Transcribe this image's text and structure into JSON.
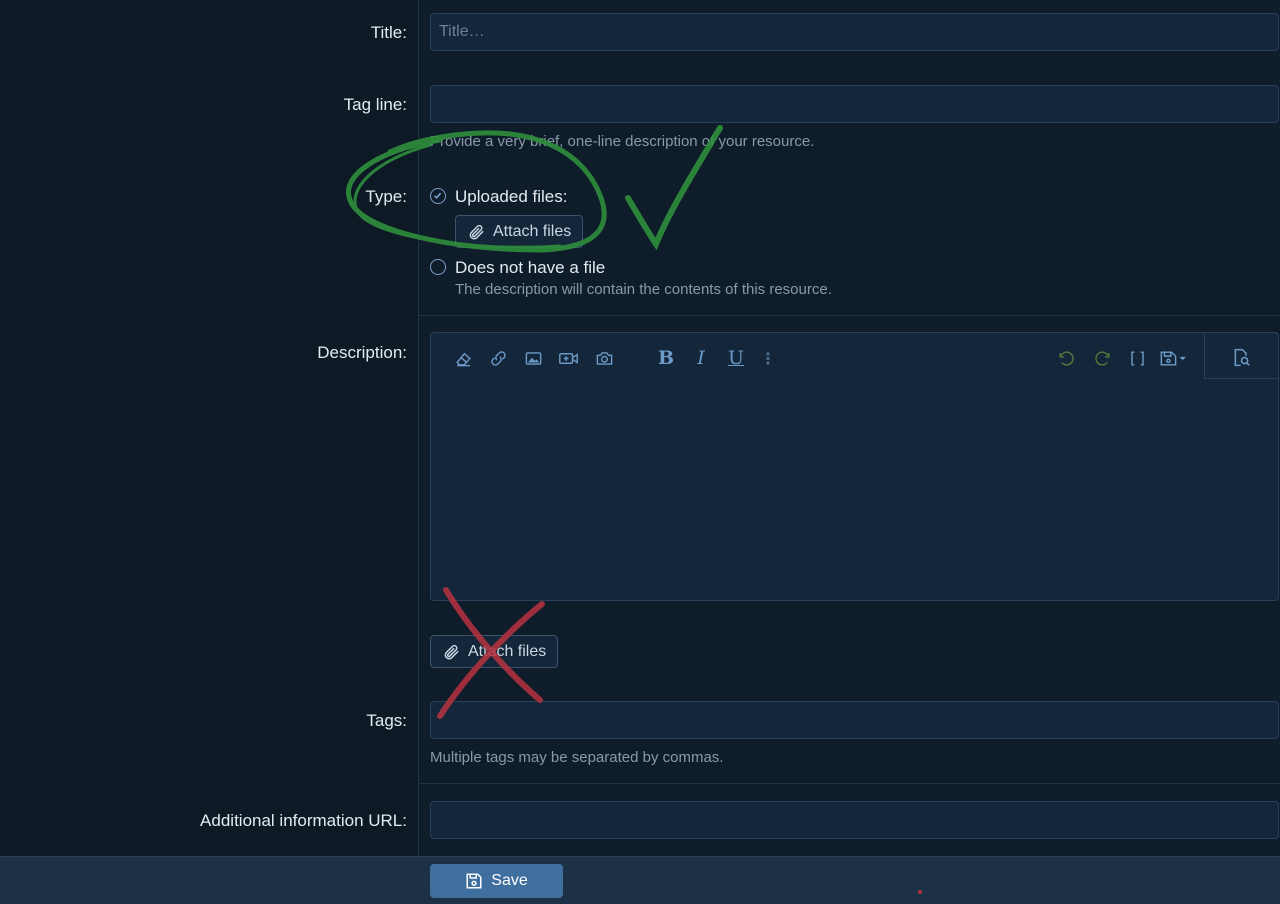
{
  "form": {
    "title": {
      "label": "Title:",
      "placeholder": "Title…",
      "value": ""
    },
    "tagline": {
      "label": "Tag line:",
      "value": "",
      "hint": "Provide a very brief, one-line description of your resource."
    },
    "type": {
      "label": "Type:",
      "option_uploaded": "Uploaded files:",
      "attach_label": "Attach files",
      "option_no_file": "Does not have a file",
      "no_file_hint": "The description will contain the contents of this resource."
    },
    "description": {
      "label": "Description:",
      "attach_label": "Attach files"
    },
    "tags": {
      "label": "Tags:",
      "value": "",
      "hint": "Multiple tags may be separated by commas."
    },
    "url": {
      "label": "Additional information URL:",
      "value": ""
    }
  },
  "footer": {
    "save_label": "Save"
  },
  "colors": {
    "accent": "#3f6f9e",
    "check_annotation": "#2f8f3c",
    "cross_annotation": "#b8323f"
  },
  "toolbar_icons": [
    "eraser-icon",
    "link-icon",
    "image-icon",
    "video-icon",
    "camera-icon",
    "bold-icon",
    "italic-icon",
    "underline-icon",
    "more-icon",
    "undo-icon",
    "redo-icon",
    "brackets-icon",
    "save-draft-icon",
    "preview-icon"
  ]
}
